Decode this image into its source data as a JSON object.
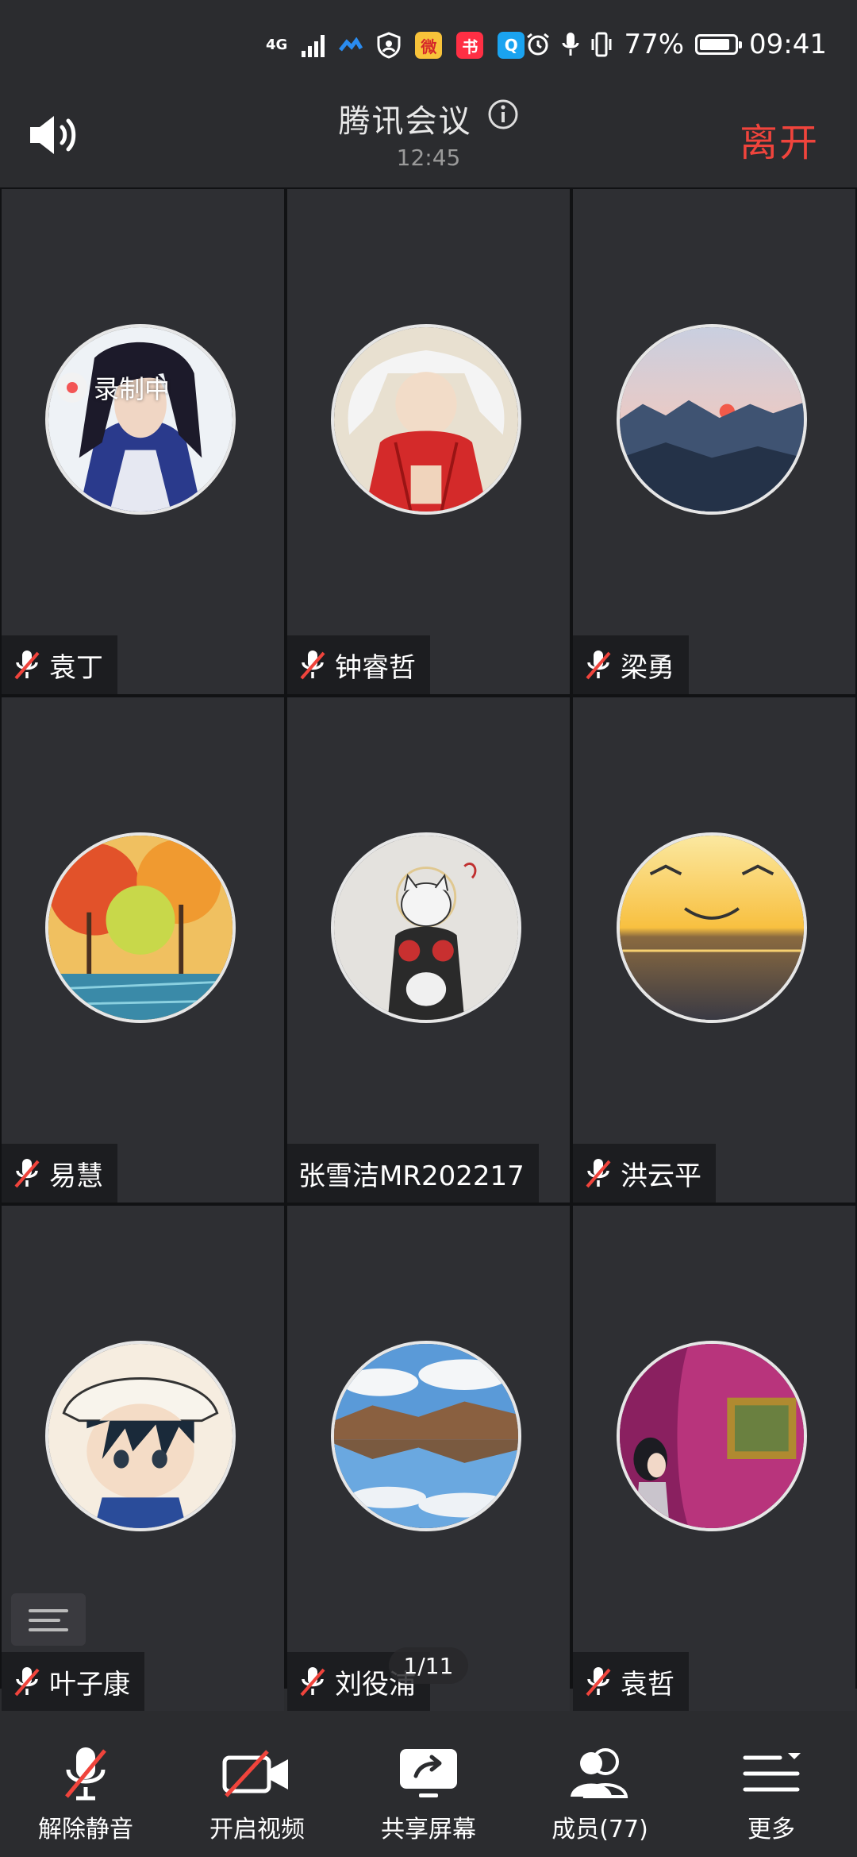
{
  "status_bar": {
    "network": "4G",
    "battery": "77%",
    "battery_level": 0.77,
    "time": "09:41",
    "app_icons": [
      "arrow-icon",
      "shield-icon",
      "weibo-icon",
      "red-book-icon",
      "search-app-icon"
    ]
  },
  "header": {
    "title": "腾讯会议",
    "timer": "12:45",
    "leave_label": "离开"
  },
  "recording_label": "录制中",
  "participants": [
    {
      "name": "袁丁",
      "muted": true,
      "avatar": "anime-swordsman"
    },
    {
      "name": "钟睿哲",
      "muted": true,
      "avatar": "anime-dog-demon"
    },
    {
      "name": "梁勇",
      "muted": true,
      "avatar": "mountain-sunset"
    },
    {
      "name": "易慧",
      "muted": true,
      "avatar": "autumn-painting"
    },
    {
      "name": "张雪洁MR202217",
      "muted": false,
      "avatar": "tattooed-cat"
    },
    {
      "name": "洪云平",
      "muted": true,
      "avatar": "sea-sunset-smile"
    },
    {
      "name": "叶子康",
      "muted": true,
      "avatar": "anime-boy-cap"
    },
    {
      "name": "刘役浦",
      "muted": true,
      "avatar": "lake-reflection"
    },
    {
      "name": "袁哲",
      "muted": true,
      "avatar": "girl-museum-painting"
    }
  ],
  "page_indicator": "1/11",
  "toolbar": {
    "unmute_label": "解除静音",
    "video_label": "开启视频",
    "share_label": "共享屏幕",
    "members_label": "成员(77)",
    "more_label": "更多"
  },
  "colors": {
    "background": "#2b2c2f",
    "tile": "#2e2f33",
    "leave": "#f0443c",
    "muted_slash": "#f0443c"
  }
}
